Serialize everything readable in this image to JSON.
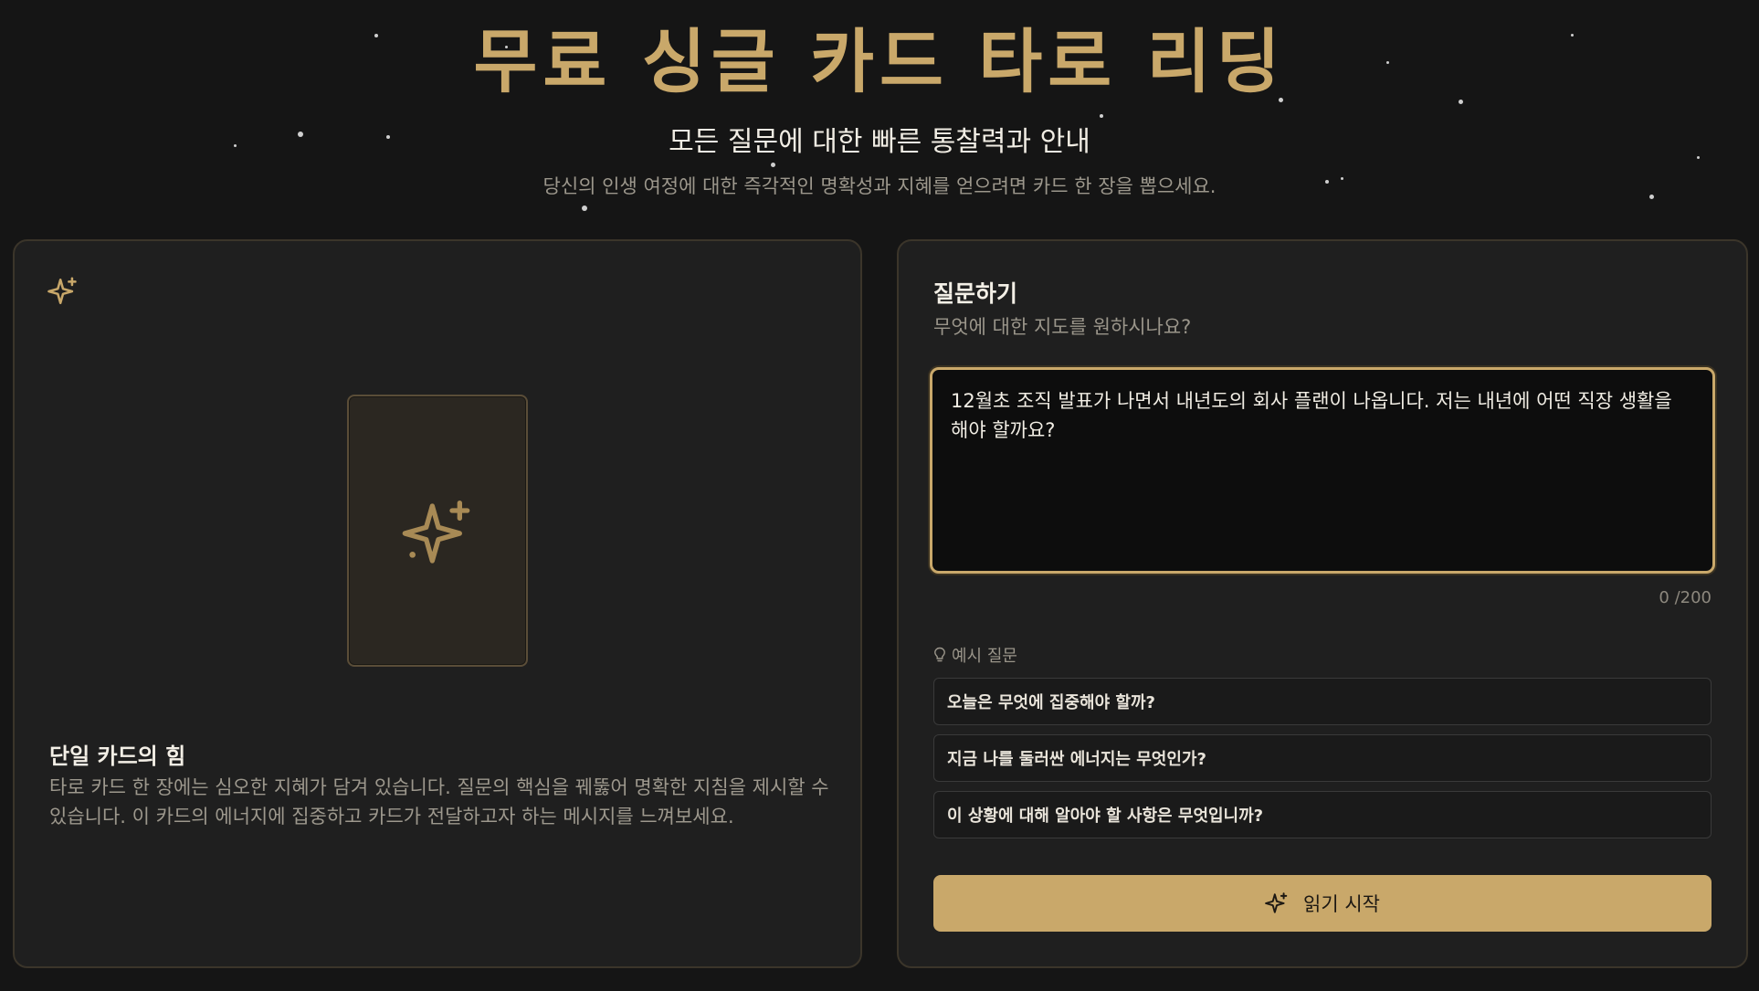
{
  "hero": {
    "title": "무료 싱글 카드 타로 리딩",
    "subtitle": "모든 질문에 대한 빠른 통찰력과 안내",
    "description": "당신의 인생 여정에 대한 즉각적인 명확성과 지혜를 얻으려면 카드 한 장을 뽑으세요."
  },
  "left_panel": {
    "corner_icon": "sparkles-icon",
    "card_icon": "sparkles-icon",
    "title": "단일 카드의 힘",
    "description": "타로 카드 한 장에는 심오한 지혜가 담겨 있습니다. 질문의 핵심을 꿰뚫어 명확한 지침을 제시할 수 있습니다. 이 카드의 에너지에 집중하고 카드가 전달하고자 하는 메시지를 느껴보세요."
  },
  "right_panel": {
    "title": "질문하기",
    "subtitle": "무엇에 대한 지도를 원하시나요?",
    "question_value": "12월초 조직 발표가 나면서 내년도의 회사 플랜이 나옵니다. 저는 내년에 어떤 직장 생활을 해야 할까요?",
    "counter": "0 /200",
    "examples_label": "예시 질문",
    "examples_icon": "lightbulb-icon",
    "examples": [
      "오늘은 무엇에 집중해야 할까?",
      "지금 나를 둘러싼 에너지는 무엇인가?",
      "이 상황에 대해 알아야 할 사항은 무엇입니까?"
    ],
    "start_button": "읽기 시작",
    "start_icon": "sparkles-icon"
  },
  "colors": {
    "background": "#151515",
    "panel": "#1f1f1f",
    "accent_gold": "#c9a86a",
    "text_primary": "#f1ede4",
    "text_muted": "#9c978c"
  }
}
